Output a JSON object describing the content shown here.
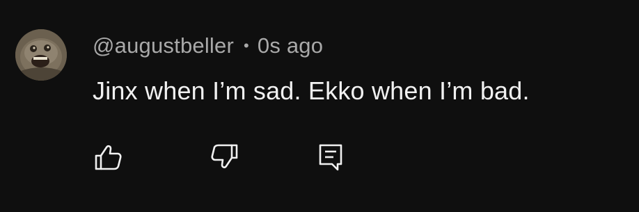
{
  "comment": {
    "author": "@augustbeller",
    "separator": "•",
    "timestamp": "0s ago",
    "text": "Jinx when I’m sad. Ekko when I’m bad."
  },
  "actions": [
    {
      "name": "like",
      "icon": "thumbs-up-icon"
    },
    {
      "name": "dislike",
      "icon": "thumbs-down-icon"
    },
    {
      "name": "reply",
      "icon": "comment-reply-icon"
    }
  ],
  "colors": {
    "background": "#0f0f0f",
    "meta_text": "#a9a9a9",
    "body_text": "#f1f1f1",
    "icon": "#f1f1f1"
  }
}
